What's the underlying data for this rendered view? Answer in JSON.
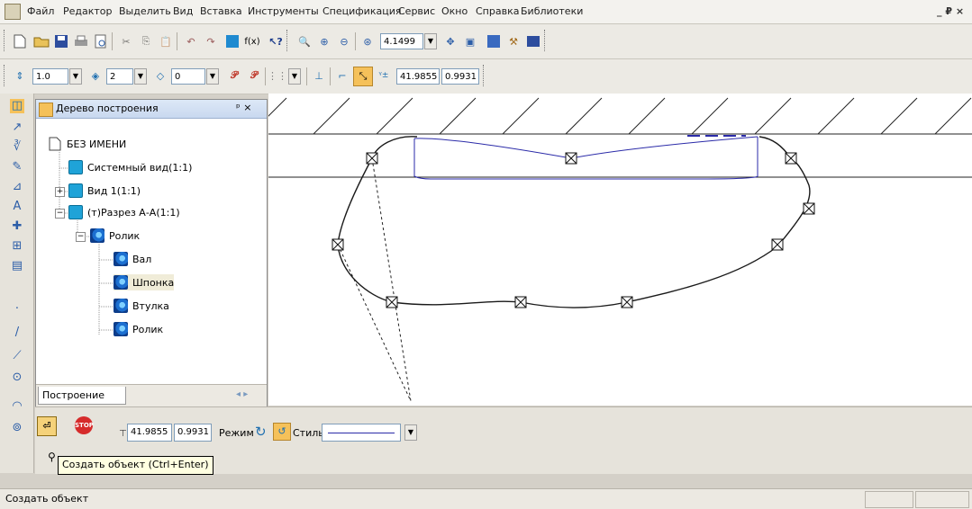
{
  "menu": [
    "Файл",
    "Редактор",
    "Выделить",
    "Вид",
    "Вставка",
    "Инструменты",
    "Спецификация",
    "Сервис",
    "Окно",
    "Справка",
    "Библиотеки"
  ],
  "window_controls": "_ ₽ ×",
  "toolbar1": {
    "zoom_value": "4.1499"
  },
  "toolbar2": {
    "scale_value": "1.0",
    "layer_value": "2",
    "style_value": "0",
    "coord_x": "41.9855",
    "coord_y": "0.9931"
  },
  "tree_panel": {
    "title": "Дерево построения",
    "header_controls": "ᵖ ×",
    "items": [
      {
        "label": "БЕЗ ИМЕНИ"
      },
      {
        "label": "Системный вид(1:1)"
      },
      {
        "label": "Вид 1(1:1)"
      },
      {
        "label": "(т)Разрез А-А(1:1)"
      },
      {
        "label": "Ролик"
      },
      {
        "label": "Вал"
      },
      {
        "label": "Шпонка"
      },
      {
        "label": "Втулка"
      },
      {
        "label": "Ролик"
      }
    ],
    "tab_label": "Построение"
  },
  "propbar": {
    "coord_x": "41.9855",
    "coord_y": "0.9931",
    "mode_label": "Режим",
    "style_label": "Стиль"
  },
  "tooltip": "Создать объект (Ctrl+Enter)",
  "status": {
    "text": "Создать объект"
  },
  "colors": {
    "accent": "#2c5ea8",
    "spline": "#1a1a1a",
    "contour_blue": "#2a2aa8",
    "tree_header": "#c8d8ef"
  }
}
